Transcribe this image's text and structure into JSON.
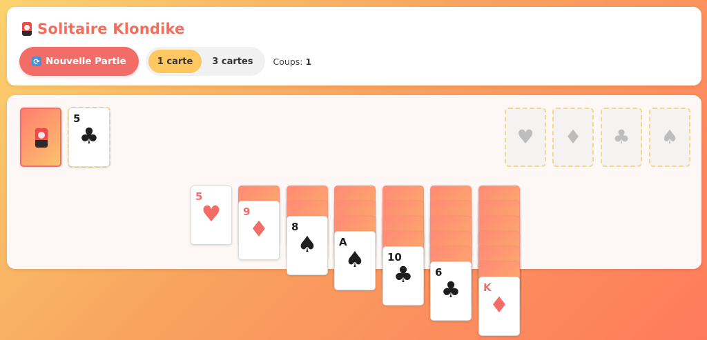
{
  "header": {
    "title": "Solitaire Klondike",
    "new_game_label": "Nouvelle Partie",
    "new_game_icon": "🔄",
    "modes": [
      "1 carte",
      "3 cartes"
    ],
    "active_mode": "1 carte",
    "moves_label": "Coups:",
    "moves_value": "1"
  },
  "stock": {
    "icon": "card-back-icon"
  },
  "waste": {
    "rank": "5",
    "suit": "♣",
    "color": "black"
  },
  "foundations": [
    {
      "suit": "♥"
    },
    {
      "suit": "♦"
    },
    {
      "suit": "♣"
    },
    {
      "suit": "♠"
    }
  ],
  "tableau": [
    {
      "hidden": 0,
      "face_up": {
        "rank": "5",
        "suit": "♥",
        "color": "red"
      }
    },
    {
      "hidden": 1,
      "face_up": {
        "rank": "9",
        "suit": "♦",
        "color": "red"
      }
    },
    {
      "hidden": 2,
      "face_up": {
        "rank": "8",
        "suit": "♠",
        "color": "black"
      }
    },
    {
      "hidden": 3,
      "face_up": {
        "rank": "A",
        "suit": "♠",
        "color": "black"
      }
    },
    {
      "hidden": 4,
      "face_up": {
        "rank": "10",
        "suit": "♣",
        "color": "black"
      }
    },
    {
      "hidden": 5,
      "face_up": {
        "rank": "6",
        "suit": "♣",
        "color": "black"
      }
    },
    {
      "hidden": 6,
      "face_up": {
        "rank": "K",
        "suit": "♦",
        "color": "red"
      }
    }
  ],
  "colors": {
    "accent": "#f26d67",
    "active_mode": "#fdc862",
    "red_suit": "#f26d67",
    "black_suit": "#1e1e1e"
  }
}
